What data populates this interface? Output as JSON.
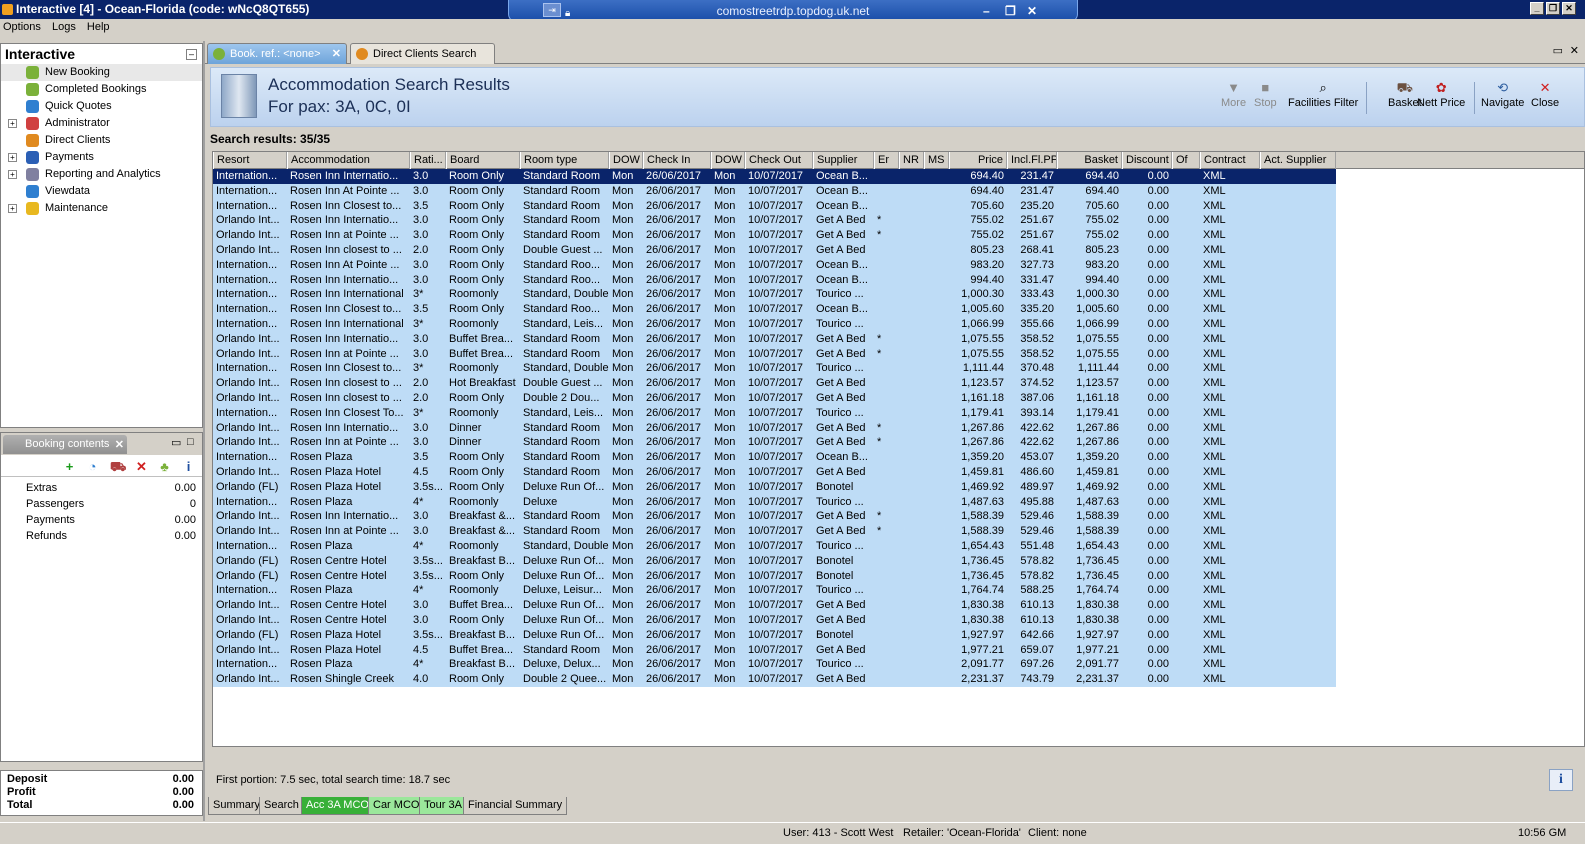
{
  "window": {
    "title": "Interactive [4] - Ocean-Florida (code: wNcQ8QT655)",
    "rdp_host": "comostreetrdp.topdog.uk.net"
  },
  "menu": [
    "Options",
    "Logs",
    "Help"
  ],
  "left": {
    "title": "Interactive",
    "items": [
      {
        "label": "New Booking",
        "icon": "palm-icon",
        "expand": false,
        "color": "#7bb13a"
      },
      {
        "label": "Completed Bookings",
        "icon": "palm-icon",
        "expand": false,
        "color": "#7bb13a"
      },
      {
        "label": "Quick Quotes",
        "icon": "globe-icon",
        "expand": false,
        "color": "#2f7fd0"
      },
      {
        "label": "Administrator",
        "icon": "person-icon",
        "expand": true,
        "color": "#d04040"
      },
      {
        "label": "Direct Clients",
        "icon": "star-icon",
        "expand": false,
        "color": "#e08a20"
      },
      {
        "label": "Payments",
        "icon": "card-icon",
        "expand": true,
        "color": "#2b5fb5"
      },
      {
        "label": "Reporting and Analytics",
        "icon": "report-icon",
        "expand": true,
        "color": "#8080a0"
      },
      {
        "label": "Viewdata",
        "icon": "globe-icon",
        "expand": false,
        "color": "#2f7fd0"
      },
      {
        "label": "Maintenance",
        "icon": "book-icon",
        "expand": true,
        "color": "#e8b820"
      }
    ]
  },
  "booking": {
    "tab_label": "Booking contents",
    "rows": [
      {
        "label": "Extras",
        "value": "0.00"
      },
      {
        "label": "Passengers",
        "value": "0"
      },
      {
        "label": "Payments",
        "value": "0.00"
      },
      {
        "label": "Refunds",
        "value": "0.00"
      }
    ],
    "totals": [
      {
        "label": "Deposit",
        "value": "0.00"
      },
      {
        "label": "Profit",
        "value": "0.00"
      },
      {
        "label": "Total",
        "value": "0.00"
      }
    ]
  },
  "tabs": [
    "Book. ref.: <none>",
    "Direct Clients Search"
  ],
  "header": {
    "title": "Accommodation Search Results",
    "pax": "For pax: 3A, 0C, 0I"
  },
  "toolbar": [
    {
      "label": "More",
      "icon": "down-arrow-icon",
      "enabled": false
    },
    {
      "label": "Stop",
      "icon": "stop-icon",
      "enabled": false
    },
    {
      "label": "Facilities Filter",
      "icon": "filter-icon",
      "enabled": true
    },
    {
      "label": "Basket",
      "icon": "basket-icon",
      "enabled": true
    },
    {
      "label": "Nett Price",
      "icon": "price-icon",
      "enabled": true
    },
    {
      "label": "Navigate",
      "icon": "navigate-icon",
      "enabled": true
    },
    {
      "label": "Close",
      "icon": "close-icon",
      "enabled": true
    }
  ],
  "search_count": "Search results: 35/35",
  "columns": [
    "Resort",
    "Accommodation",
    "Rati...",
    "Board",
    "Room type",
    "DOW",
    "Check In",
    "DOW",
    "Check Out",
    "Supplier",
    "Er",
    "NR",
    "MS",
    "Price",
    "Incl.Fl.PP",
    "Basket",
    "Discount",
    "Of",
    "Contract",
    "Act. Supplier"
  ],
  "rows": [
    [
      "Internation...",
      "Rosen Inn Internatio...",
      "3.0",
      "Room Only",
      "Standard Room",
      "Mon",
      "26/06/2017",
      "Mon",
      "10/07/2017",
      "Ocean B...",
      "",
      "",
      "",
      "694.40",
      "231.47",
      "694.40",
      "0.00",
      "",
      "XML",
      ""
    ],
    [
      "Internation...",
      "Rosen Inn At Pointe ...",
      "3.0",
      "Room Only",
      "Standard Room",
      "Mon",
      "26/06/2017",
      "Mon",
      "10/07/2017",
      "Ocean B...",
      "",
      "",
      "",
      "694.40",
      "231.47",
      "694.40",
      "0.00",
      "",
      "XML",
      ""
    ],
    [
      "Internation...",
      "Rosen Inn Closest to...",
      "3.5",
      "Room Only",
      "Standard Room",
      "Mon",
      "26/06/2017",
      "Mon",
      "10/07/2017",
      "Ocean B...",
      "",
      "",
      "",
      "705.60",
      "235.20",
      "705.60",
      "0.00",
      "",
      "XML",
      ""
    ],
    [
      "Orlando Int...",
      "Rosen Inn Internatio...",
      "3.0",
      "Room Only",
      "Standard Room",
      "Mon",
      "26/06/2017",
      "Mon",
      "10/07/2017",
      "Get A Bed",
      "*",
      "",
      "",
      "755.02",
      "251.67",
      "755.02",
      "0.00",
      "",
      "XML",
      ""
    ],
    [
      "Orlando Int...",
      "Rosen Inn at Pointe ...",
      "3.0",
      "Room Only",
      "Standard Room",
      "Mon",
      "26/06/2017",
      "Mon",
      "10/07/2017",
      "Get A Bed",
      "*",
      "",
      "",
      "755.02",
      "251.67",
      "755.02",
      "0.00",
      "",
      "XML",
      ""
    ],
    [
      "Orlando Int...",
      "Rosen Inn closest to ...",
      "2.0",
      "Room Only",
      "Double Guest ...",
      "Mon",
      "26/06/2017",
      "Mon",
      "10/07/2017",
      "Get A Bed",
      "",
      "",
      "",
      "805.23",
      "268.41",
      "805.23",
      "0.00",
      "",
      "XML",
      ""
    ],
    [
      "Internation...",
      "Rosen Inn At Pointe ...",
      "3.0",
      "Room Only",
      "Standard Roo...",
      "Mon",
      "26/06/2017",
      "Mon",
      "10/07/2017",
      "Ocean B...",
      "",
      "",
      "",
      "983.20",
      "327.73",
      "983.20",
      "0.00",
      "",
      "XML",
      ""
    ],
    [
      "Internation...",
      "Rosen Inn Internatio...",
      "3.0",
      "Room Only",
      "Standard Roo...",
      "Mon",
      "26/06/2017",
      "Mon",
      "10/07/2017",
      "Ocean B...",
      "",
      "",
      "",
      "994.40",
      "331.47",
      "994.40",
      "0.00",
      "",
      "XML",
      ""
    ],
    [
      "Internation...",
      "Rosen Inn International",
      "3*",
      "Roomonly",
      "Standard, Double",
      "Mon",
      "26/06/2017",
      "Mon",
      "10/07/2017",
      "Tourico ...",
      "",
      "",
      "",
      "1,000.30",
      "333.43",
      "1,000.30",
      "0.00",
      "",
      "XML",
      ""
    ],
    [
      "Internation...",
      "Rosen Inn Closest to...",
      "3.5",
      "Room Only",
      "Standard Roo...",
      "Mon",
      "26/06/2017",
      "Mon",
      "10/07/2017",
      "Ocean B...",
      "",
      "",
      "",
      "1,005.60",
      "335.20",
      "1,005.60",
      "0.00",
      "",
      "XML",
      ""
    ],
    [
      "Internation...",
      "Rosen Inn International",
      "3*",
      "Roomonly",
      "Standard, Leis...",
      "Mon",
      "26/06/2017",
      "Mon",
      "10/07/2017",
      "Tourico ...",
      "",
      "",
      "",
      "1,066.99",
      "355.66",
      "1,066.99",
      "0.00",
      "",
      "XML",
      ""
    ],
    [
      "Orlando Int...",
      "Rosen Inn Internatio...",
      "3.0",
      "Buffet Brea...",
      "Standard Room",
      "Mon",
      "26/06/2017",
      "Mon",
      "10/07/2017",
      "Get A Bed",
      "*",
      "",
      "",
      "1,075.55",
      "358.52",
      "1,075.55",
      "0.00",
      "",
      "XML",
      ""
    ],
    [
      "Orlando Int...",
      "Rosen Inn at Pointe ...",
      "3.0",
      "Buffet Brea...",
      "Standard Room",
      "Mon",
      "26/06/2017",
      "Mon",
      "10/07/2017",
      "Get A Bed",
      "*",
      "",
      "",
      "1,075.55",
      "358.52",
      "1,075.55",
      "0.00",
      "",
      "XML",
      ""
    ],
    [
      "Internation...",
      "Rosen Inn Closest to...",
      "3*",
      "Roomonly",
      "Standard, Double",
      "Mon",
      "26/06/2017",
      "Mon",
      "10/07/2017",
      "Tourico ...",
      "",
      "",
      "",
      "1,111.44",
      "370.48",
      "1,111.44",
      "0.00",
      "",
      "XML",
      ""
    ],
    [
      "Orlando Int...",
      "Rosen Inn closest to ...",
      "2.0",
      "Hot Breakfast",
      "Double Guest ...",
      "Mon",
      "26/06/2017",
      "Mon",
      "10/07/2017",
      "Get A Bed",
      "",
      "",
      "",
      "1,123.57",
      "374.52",
      "1,123.57",
      "0.00",
      "",
      "XML",
      ""
    ],
    [
      "Orlando Int...",
      "Rosen Inn closest to ...",
      "2.0",
      "Room Only",
      "Double 2  Dou...",
      "Mon",
      "26/06/2017",
      "Mon",
      "10/07/2017",
      "Get A Bed",
      "",
      "",
      "",
      "1,161.18",
      "387.06",
      "1,161.18",
      "0.00",
      "",
      "XML",
      ""
    ],
    [
      "Internation...",
      "Rosen Inn Closest To...",
      "3*",
      "Roomonly",
      "Standard, Leis...",
      "Mon",
      "26/06/2017",
      "Mon",
      "10/07/2017",
      "Tourico ...",
      "",
      "",
      "",
      "1,179.41",
      "393.14",
      "1,179.41",
      "0.00",
      "",
      "XML",
      ""
    ],
    [
      "Orlando Int...",
      "Rosen Inn Internatio...",
      "3.0",
      "Dinner",
      "Standard Room",
      "Mon",
      "26/06/2017",
      "Mon",
      "10/07/2017",
      "Get A Bed",
      "*",
      "",
      "",
      "1,267.86",
      "422.62",
      "1,267.86",
      "0.00",
      "",
      "XML",
      ""
    ],
    [
      "Orlando Int...",
      "Rosen Inn at Pointe ...",
      "3.0",
      "Dinner",
      "Standard Room",
      "Mon",
      "26/06/2017",
      "Mon",
      "10/07/2017",
      "Get A Bed",
      "*",
      "",
      "",
      "1,267.86",
      "422.62",
      "1,267.86",
      "0.00",
      "",
      "XML",
      ""
    ],
    [
      "Internation...",
      "Rosen Plaza",
      "3.5",
      "Room Only",
      "Standard Room",
      "Mon",
      "26/06/2017",
      "Mon",
      "10/07/2017",
      "Ocean B...",
      "",
      "",
      "",
      "1,359.20",
      "453.07",
      "1,359.20",
      "0.00",
      "",
      "XML",
      ""
    ],
    [
      "Orlando Int...",
      "Rosen Plaza Hotel",
      "4.5",
      "Room Only",
      "Standard Room",
      "Mon",
      "26/06/2017",
      "Mon",
      "10/07/2017",
      "Get A Bed",
      "",
      "",
      "",
      "1,459.81",
      "486.60",
      "1,459.81",
      "0.00",
      "",
      "XML",
      ""
    ],
    [
      "Orlando (FL)",
      "Rosen Plaza Hotel",
      "3.5s...",
      "Room Only",
      "Deluxe Run Of...",
      "Mon",
      "26/06/2017",
      "Mon",
      "10/07/2017",
      "Bonotel",
      "",
      "",
      "",
      "1,469.92",
      "489.97",
      "1,469.92",
      "0.00",
      "",
      "XML",
      ""
    ],
    [
      "Internation...",
      "Rosen Plaza",
      "4*",
      "Roomonly",
      "Deluxe",
      "Mon",
      "26/06/2017",
      "Mon",
      "10/07/2017",
      "Tourico ...",
      "",
      "",
      "",
      "1,487.63",
      "495.88",
      "1,487.63",
      "0.00",
      "",
      "XML",
      ""
    ],
    [
      "Orlando Int...",
      "Rosen Inn Internatio...",
      "3.0",
      "Breakfast &...",
      "Standard Room",
      "Mon",
      "26/06/2017",
      "Mon",
      "10/07/2017",
      "Get A Bed",
      "*",
      "",
      "",
      "1,588.39",
      "529.46",
      "1,588.39",
      "0.00",
      "",
      "XML",
      ""
    ],
    [
      "Orlando Int...",
      "Rosen Inn at Pointe ...",
      "3.0",
      "Breakfast &...",
      "Standard Room",
      "Mon",
      "26/06/2017",
      "Mon",
      "10/07/2017",
      "Get A Bed",
      "*",
      "",
      "",
      "1,588.39",
      "529.46",
      "1,588.39",
      "0.00",
      "",
      "XML",
      ""
    ],
    [
      "Internation...",
      "Rosen Plaza",
      "4*",
      "Roomonly",
      "Standard, Double",
      "Mon",
      "26/06/2017",
      "Mon",
      "10/07/2017",
      "Tourico ...",
      "",
      "",
      "",
      "1,654.43",
      "551.48",
      "1,654.43",
      "0.00",
      "",
      "XML",
      ""
    ],
    [
      "Orlando (FL)",
      "Rosen Centre Hotel",
      "3.5s...",
      "Breakfast B...",
      "Deluxe Run Of...",
      "Mon",
      "26/06/2017",
      "Mon",
      "10/07/2017",
      "Bonotel",
      "",
      "",
      "",
      "1,736.45",
      "578.82",
      "1,736.45",
      "0.00",
      "",
      "XML",
      ""
    ],
    [
      "Orlando (FL)",
      "Rosen Centre Hotel",
      "3.5s...",
      "Room Only",
      "Deluxe Run Of...",
      "Mon",
      "26/06/2017",
      "Mon",
      "10/07/2017",
      "Bonotel",
      "",
      "",
      "",
      "1,736.45",
      "578.82",
      "1,736.45",
      "0.00",
      "",
      "XML",
      ""
    ],
    [
      "Internation...",
      "Rosen Plaza",
      "4*",
      "Roomonly",
      "Deluxe, Leisur...",
      "Mon",
      "26/06/2017",
      "Mon",
      "10/07/2017",
      "Tourico ...",
      "",
      "",
      "",
      "1,764.74",
      "588.25",
      "1,764.74",
      "0.00",
      "",
      "XML",
      ""
    ],
    [
      "Orlando Int...",
      "Rosen Centre Hotel",
      "3.0",
      "Buffet Brea...",
      "Deluxe Run Of...",
      "Mon",
      "26/06/2017",
      "Mon",
      "10/07/2017",
      "Get A Bed",
      "",
      "",
      "",
      "1,830.38",
      "610.13",
      "1,830.38",
      "0.00",
      "",
      "XML",
      ""
    ],
    [
      "Orlando Int...",
      "Rosen Centre Hotel",
      "3.0",
      "Room Only",
      "Deluxe Run Of...",
      "Mon",
      "26/06/2017",
      "Mon",
      "10/07/2017",
      "Get A Bed",
      "",
      "",
      "",
      "1,830.38",
      "610.13",
      "1,830.38",
      "0.00",
      "",
      "XML",
      ""
    ],
    [
      "Orlando (FL)",
      "Rosen Plaza Hotel",
      "3.5s...",
      "Breakfast B...",
      "Deluxe Run Of...",
      "Mon",
      "26/06/2017",
      "Mon",
      "10/07/2017",
      "Bonotel",
      "",
      "",
      "",
      "1,927.97",
      "642.66",
      "1,927.97",
      "0.00",
      "",
      "XML",
      ""
    ],
    [
      "Orlando Int...",
      "Rosen Plaza Hotel",
      "4.5",
      "Buffet Brea...",
      "Standard Room",
      "Mon",
      "26/06/2017",
      "Mon",
      "10/07/2017",
      "Get A Bed",
      "",
      "",
      "",
      "1,977.21",
      "659.07",
      "1,977.21",
      "0.00",
      "",
      "XML",
      ""
    ],
    [
      "Internation...",
      "Rosen Plaza",
      "4*",
      "Breakfast B...",
      "Deluxe, Delux...",
      "Mon",
      "26/06/2017",
      "Mon",
      "10/07/2017",
      "Tourico ...",
      "",
      "",
      "",
      "2,091.77",
      "697.26",
      "2,091.77",
      "0.00",
      "",
      "XML",
      ""
    ],
    [
      "Orlando Int...",
      "Rosen Shingle Creek",
      "4.0",
      "Room Only",
      "Double 2 Quee...",
      "Mon",
      "26/06/2017",
      "Mon",
      "10/07/2017",
      "Get A Bed",
      "",
      "",
      "",
      "2,231.37",
      "743.79",
      "2,231.37",
      "0.00",
      "",
      "XML",
      ""
    ]
  ],
  "status_msg": "First portion: 7.5 sec, total search time: 18.7 sec",
  "bottom_tabs": [
    {
      "label": "Summary",
      "style": "plain"
    },
    {
      "label": "Search",
      "style": "plain"
    },
    {
      "label": "Acc 3A MCO",
      "style": "active"
    },
    {
      "label": "Car MCO",
      "style": "green"
    },
    {
      "label": "Tour 3A",
      "style": "green"
    },
    {
      "label": "Financial Summary",
      "style": "plain"
    }
  ],
  "status": {
    "user": "User: 413 - Scott West",
    "retailer": "Retailer: 'Ocean-Florida'",
    "client": "Client: none",
    "time": "10:56 GM"
  }
}
